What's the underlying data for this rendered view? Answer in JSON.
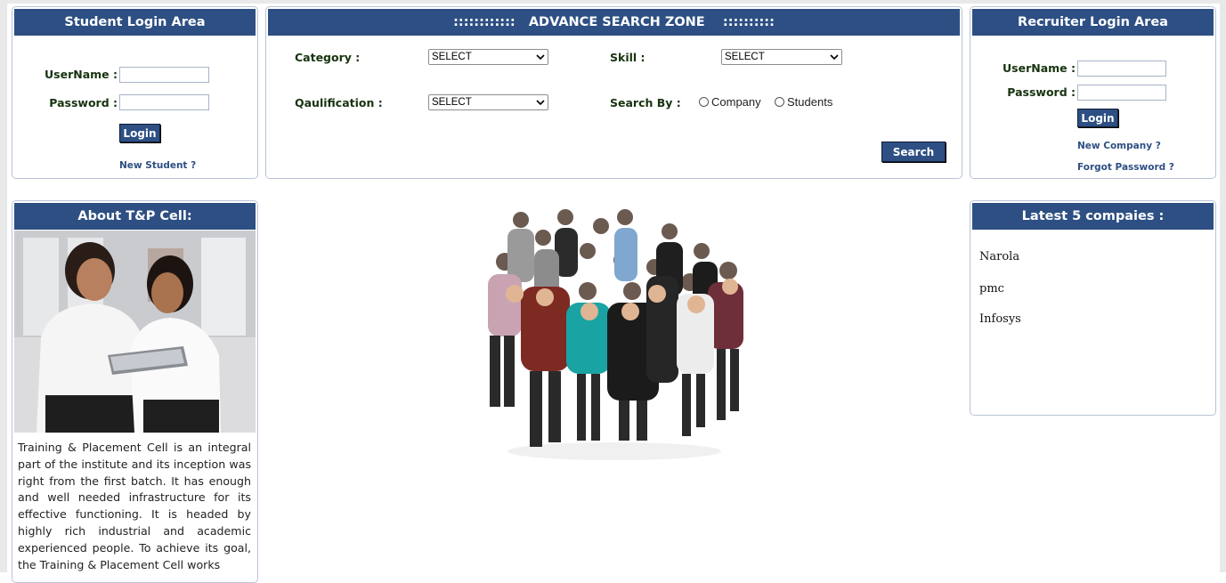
{
  "student_login": {
    "title": "Student Login Area",
    "username_label": "UserName :",
    "password_label": "Password :",
    "login_button": "Login",
    "new_student_link": "New Student ?"
  },
  "advance_search": {
    "title": "::::::::::::   ADVANCE SEARCH ZONE    ::::::::::",
    "category_label": "Category  :",
    "category_value": "SELECT",
    "skill_label": "Skill :",
    "skill_value": "SELECT",
    "qualification_label": "Qaulification :",
    "qualification_value": "SELECT",
    "search_by_label": "Search By :",
    "radio_company": "Company",
    "radio_students": "Students",
    "search_button": "Search"
  },
  "recruiter_login": {
    "title": "Recruiter Login Area",
    "username_label": "UserName :",
    "password_label": "Password :",
    "login_button": "Login",
    "new_company_link": "New Company ?",
    "forgot_password_link": "Forgot Password ?"
  },
  "about": {
    "title": "About T&P Cell:",
    "text": "Training & Placement Cell is an integral part of the institute and its inception was right from the first batch. It has enough and well needed infrastructure for its effective functioning. It is headed by highly rich industrial and academic experienced people. To achieve its goal, the Training & Placement Cell works"
  },
  "latest_companies": {
    "title": "Latest 5 compaies :",
    "items": [
      "Narola",
      "pmc",
      "Infosys"
    ]
  },
  "colors": {
    "header_blue": "#2d4f83",
    "label_green": "#17330f"
  }
}
